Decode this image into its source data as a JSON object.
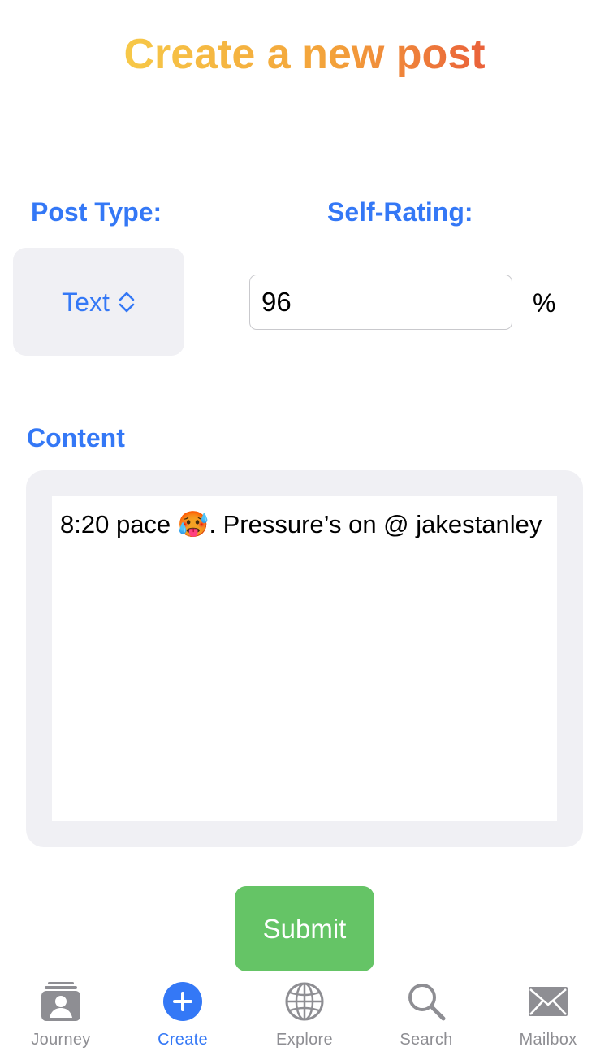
{
  "header": {
    "title": "Create a new post"
  },
  "form": {
    "post_type_label": "Post Type:",
    "post_type_value": "Text",
    "self_rating_label": "Self-Rating:",
    "self_rating_value": "96",
    "self_rating_unit": "%",
    "content_label": "Content",
    "content_value": "8:20 pace 🥵. Pressure’s on @ jakestanley",
    "submit_label": "Submit"
  },
  "tab_bar": {
    "active": "Create",
    "tabs": [
      {
        "label": "Journey",
        "icon": "journey-icon"
      },
      {
        "label": "Create",
        "icon": "plus-circle-icon"
      },
      {
        "label": "Explore",
        "icon": "globe-icon"
      },
      {
        "label": "Search",
        "icon": "magnifier-icon"
      },
      {
        "label": "Mailbox",
        "icon": "envelope-icon"
      }
    ]
  },
  "colors": {
    "accent": "#3478f6",
    "submit": "#65c466",
    "title_gradient_start": "#f7c948",
    "title_gradient_end": "#e8533a",
    "inactive_tab": "#8e8e93",
    "panel_background": "#f0f0f4"
  }
}
